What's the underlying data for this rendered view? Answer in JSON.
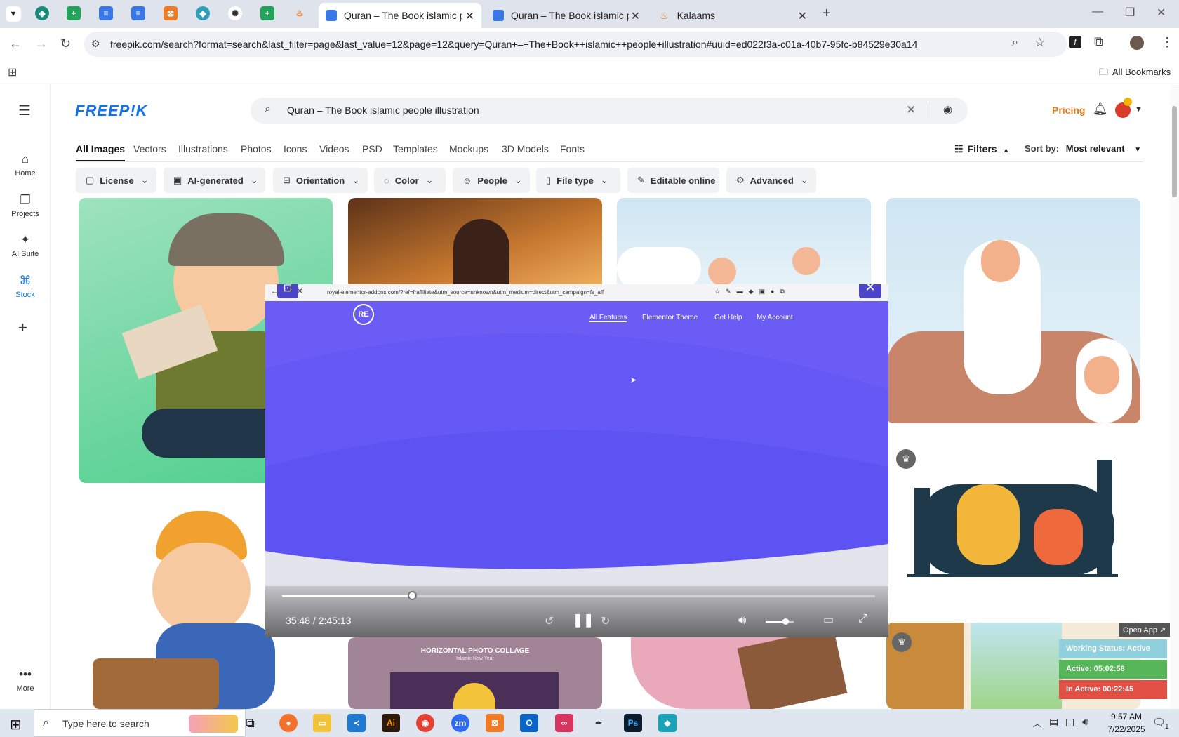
{
  "browser": {
    "tabs": [
      {
        "title": "Quran – The Book islamic people illustration",
        "active": true
      },
      {
        "title": "Quran – The Book islamic people illustration",
        "active": false
      },
      {
        "title": "Kalaams",
        "active": false
      }
    ],
    "url": "freepik.com/search?format=search&last_filter=page&last_value=12&page=12&query=Quran+–+The+Book++islamic++people+illustration#uuid=ed022f3a-c01a-40b7-95fc-b84529e30a14",
    "bookmarks_label": "All Bookmarks"
  },
  "freepik": {
    "logo": "FREEP!K",
    "search_value": "Quran – The Book  islamic  people illustration",
    "pricing_label": "Pricing",
    "sidebar": [
      {
        "label": "Home",
        "icon": "home-icon"
      },
      {
        "label": "Projects",
        "icon": "projects-icon"
      },
      {
        "label": "AI Suite",
        "icon": "ai-suite-icon"
      },
      {
        "label": "Stock",
        "icon": "stock-icon"
      },
      {
        "label": "More",
        "icon": "more-icon"
      }
    ],
    "type_tabs": [
      "All Images",
      "Vectors",
      "Illustrations",
      "Photos",
      "Icons",
      "Videos",
      "PSD",
      "Templates",
      "Mockups",
      "3D Models",
      "Fonts"
    ],
    "filters_label": "Filters",
    "sort_label": "Sort by:",
    "sort_value": "Most relevant",
    "chips": [
      "License",
      "AI-generated",
      "Orientation",
      "Color",
      "People",
      "File type",
      "Editable online",
      "Advanced"
    ],
    "collage_title": "HORIZONTAL PHOTO COLLAGE",
    "collage_subtitle": "Islamic New Year"
  },
  "video_overlay": {
    "mini_url": "royal-elementor-addons.com/?ref=fraffiliate&utm_source=unknown&utm_medium=direct&utm_campaign=fs_aff",
    "logo": "RE",
    "nav": [
      "All Features",
      "Elementor Theme",
      "Get Help",
      "My Account"
    ],
    "time": "35:48 / 2:45:13",
    "progress": 0.22,
    "volume": 0.6
  },
  "status_widget": {
    "open_app": "Open App ↗",
    "working_status": "Working Status: Active",
    "active": "Active: 05:02:58",
    "inactive": "In Active: 00:22:45"
  },
  "taskbar": {
    "search_placeholder": "Type here to search",
    "time": "9:57 AM",
    "date": "7/22/2025",
    "notifications_count": "1"
  }
}
